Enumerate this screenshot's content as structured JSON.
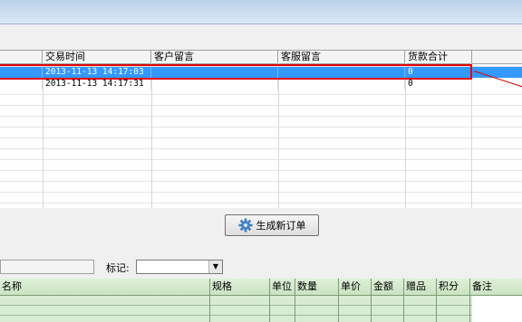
{
  "upper_table": {
    "columns": [
      "交易时间",
      "客户留言",
      "客服留言",
      "货款合计"
    ],
    "rows": [
      {
        "time": "2013-11-13 14:17:03",
        "customer_msg": "",
        "service_msg": "",
        "total": "0",
        "selected": true
      },
      {
        "time": "2013-11-13 14:17:31",
        "customer_msg": "",
        "service_msg": "",
        "total": "0",
        "selected": false
      }
    ]
  },
  "generate_button": {
    "label": "生成新订单",
    "icon": "gear-icon"
  },
  "mark": {
    "label": "标记:",
    "value": ""
  },
  "lower_table": {
    "columns": [
      "名称",
      "规格",
      "单位",
      "数量",
      "单价",
      "金额",
      "赠品",
      "积分",
      "备注"
    ]
  },
  "colors": {
    "selection": "#3399ff",
    "highlight": "#e00000",
    "lower_grid": "#d7ecd2"
  }
}
